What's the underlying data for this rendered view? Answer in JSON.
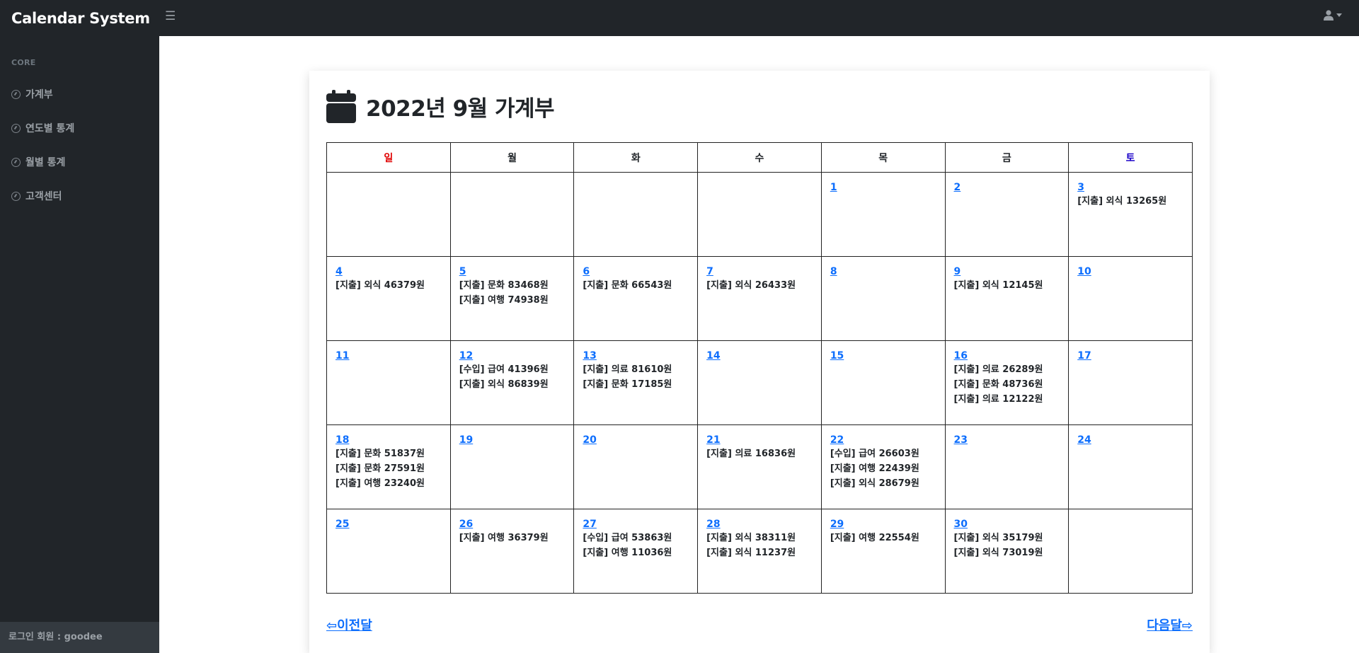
{
  "app": {
    "brand": "Calendar System"
  },
  "sidebar": {
    "heading": "CORE",
    "items": [
      {
        "label": "가계부"
      },
      {
        "label": "연도별 통계"
      },
      {
        "label": "월별 통계"
      },
      {
        "label": "고객센터"
      }
    ],
    "footer": "로그인 회원 : goodee"
  },
  "page": {
    "title": "2022년 9월 가계부",
    "prev": "⇦이전달",
    "next": "다음달⇨"
  },
  "calendar": {
    "weekdays": [
      "일",
      "월",
      "화",
      "수",
      "목",
      "금",
      "토"
    ],
    "weekday_colors": [
      "#e00000",
      "#212529",
      "#212529",
      "#212529",
      "#212529",
      "#212529",
      "#1a00c8"
    ],
    "weeks": [
      [
        null,
        null,
        null,
        null,
        {
          "day": "1",
          "entries": []
        },
        {
          "day": "2",
          "entries": []
        },
        {
          "day": "3",
          "entries": [
            "[지출] 외식 13265원"
          ]
        }
      ],
      [
        {
          "day": "4",
          "entries": [
            "[지출] 외식 46379원"
          ]
        },
        {
          "day": "5",
          "entries": [
            "[지출] 문화 83468원",
            "[지출] 여행 74938원"
          ]
        },
        {
          "day": "6",
          "entries": [
            "[지출] 문화 66543원"
          ]
        },
        {
          "day": "7",
          "entries": [
            "[지출] 외식 26433원"
          ]
        },
        {
          "day": "8",
          "entries": []
        },
        {
          "day": "9",
          "entries": [
            "[지출] 외식 12145원"
          ]
        },
        {
          "day": "10",
          "entries": []
        }
      ],
      [
        {
          "day": "11",
          "entries": []
        },
        {
          "day": "12",
          "entries": [
            "[수입] 급여 41396원",
            "[지출] 외식 86839원"
          ]
        },
        {
          "day": "13",
          "entries": [
            "[지출] 의료 81610원",
            "[지출] 문화 17185원"
          ]
        },
        {
          "day": "14",
          "entries": []
        },
        {
          "day": "15",
          "entries": []
        },
        {
          "day": "16",
          "entries": [
            "[지출] 의료 26289원",
            "[지출] 문화 48736원",
            "[지출] 의료 12122원"
          ]
        },
        {
          "day": "17",
          "entries": []
        }
      ],
      [
        {
          "day": "18",
          "entries": [
            "[지출] 문화 51837원",
            "[지출] 문화 27591원",
            "[지출] 여행 23240원"
          ]
        },
        {
          "day": "19",
          "entries": []
        },
        {
          "day": "20",
          "entries": []
        },
        {
          "day": "21",
          "entries": [
            "[지출] 의료 16836원"
          ]
        },
        {
          "day": "22",
          "entries": [
            "[수입] 급여 26603원",
            "[지출] 여행 22439원",
            "[지출] 외식 28679원"
          ]
        },
        {
          "day": "23",
          "entries": []
        },
        {
          "day": "24",
          "entries": []
        }
      ],
      [
        {
          "day": "25",
          "entries": []
        },
        {
          "day": "26",
          "entries": [
            "[지출] 여행 36379원"
          ]
        },
        {
          "day": "27",
          "entries": [
            "[수입] 급여 53863원",
            "[지출] 여행 11036원"
          ]
        },
        {
          "day": "28",
          "entries": [
            "[지출] 외식 38311원",
            "[지출] 외식 11237원"
          ]
        },
        {
          "day": "29",
          "entries": [
            "[지출] 여행 22554원"
          ]
        },
        {
          "day": "30",
          "entries": [
            "[지출] 외식 35179원",
            "[지출] 외식 73019원"
          ]
        },
        null
      ]
    ]
  }
}
